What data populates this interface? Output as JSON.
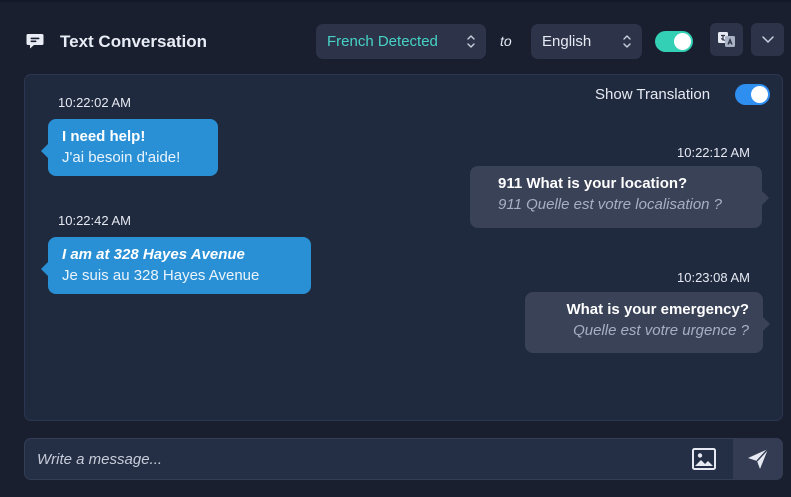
{
  "header": {
    "title": "Text Conversation",
    "source_language": "French Detected",
    "to_label": "to",
    "target_language": "English",
    "auto_translate_on": true
  },
  "chat": {
    "show_translation_label": "Show Translation",
    "show_translation_on": true,
    "messages": [
      {
        "time": "10:22:02 AM",
        "direction": "incoming",
        "original": "I need help!",
        "translation": "J'ai besoin d'aide!"
      },
      {
        "time": "10:22:12 AM",
        "direction": "outgoing",
        "original": "911 What is your location?",
        "translation": "911 Quelle est votre localisation ?"
      },
      {
        "time": "10:22:42 AM",
        "direction": "incoming",
        "original": "I am at 328 Hayes Avenue",
        "translation": "Je suis au 328 Hayes Avenue"
      },
      {
        "time": "10:23:08 AM",
        "direction": "outgoing",
        "original": "What is your emergency?",
        "translation": "Quelle est votre urgence ?"
      }
    ]
  },
  "composer": {
    "placeholder": "Write a message..."
  },
  "colors": {
    "background": "#1a1f30",
    "panel": "#1f2a3e",
    "incoming_bubble": "#2a90d6",
    "outgoing_bubble": "#3a4258",
    "accent_teal": "#34d0b5",
    "accent_blue": "#2e8ff0",
    "detected_text": "#46d3c6"
  },
  "icons": {
    "title": "chat-bubble-icon",
    "select": "chevron-up-down-icon",
    "translate": "translate-icon",
    "more": "chevron-down-icon",
    "attach": "image-icon",
    "send": "send-icon"
  }
}
